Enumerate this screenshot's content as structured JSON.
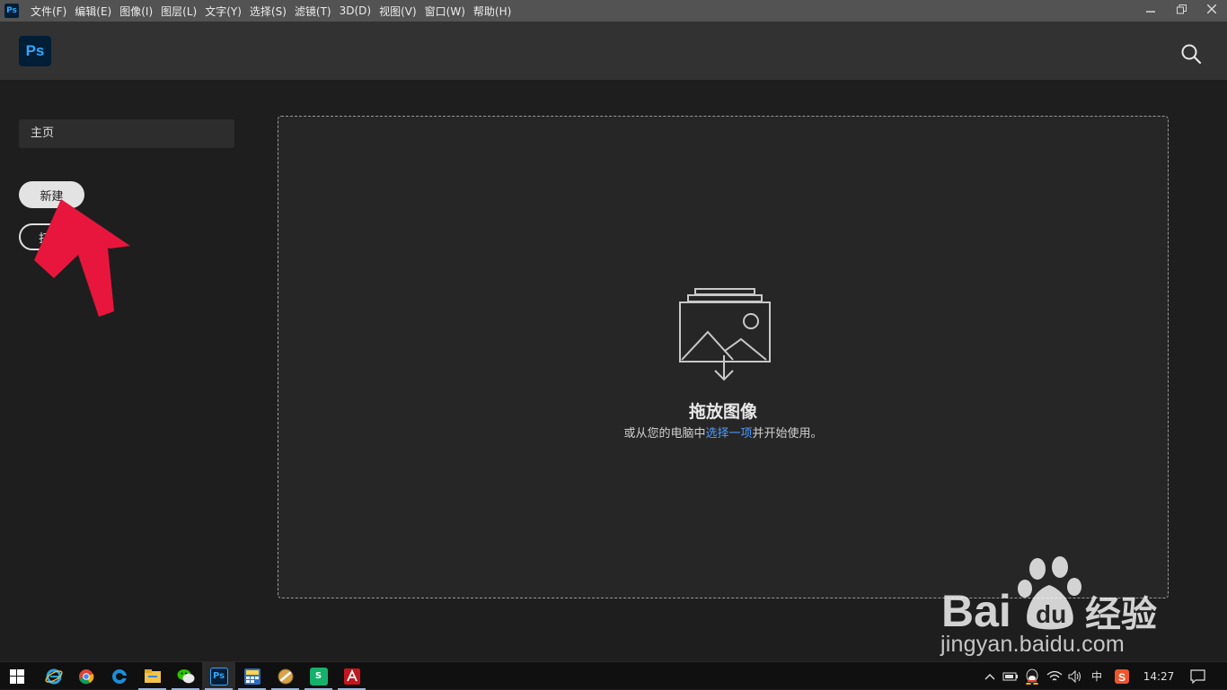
{
  "menubar": {
    "app_icon": "Ps",
    "items": [
      "文件(F)",
      "编辑(E)",
      "图像(I)",
      "图层(L)",
      "文字(Y)",
      "选择(S)",
      "滤镜(T)",
      "3D(D)",
      "视图(V)",
      "窗口(W)",
      "帮助(H)"
    ],
    "window_controls": [
      "minimize-icon",
      "restore-icon",
      "close-icon"
    ]
  },
  "header": {
    "logo": "Ps",
    "search_icon": "search-icon"
  },
  "sidebar": {
    "home_label": "主页",
    "new_label": "新建",
    "open_label": "打"
  },
  "dropzone": {
    "icon": "image-download-icon",
    "title": "拖放图像",
    "subtitle_prefix": "或从您的电脑中",
    "subtitle_link": "选择一项",
    "subtitle_suffix": "并开始使用。"
  },
  "watermark": {
    "brand": "Baidu 经验",
    "url": "jingyan.baidu.com"
  },
  "taskbar": {
    "apps": [
      {
        "icon": "windows-start-icon"
      },
      {
        "icon": "ie-browser-icon"
      },
      {
        "icon": "chrome-icon"
      },
      {
        "icon": "edge-browser-icon"
      },
      {
        "icon": "file-explorer-icon"
      },
      {
        "icon": "wechat-icon"
      },
      {
        "icon": "photoshop-icon",
        "label": "Ps"
      },
      {
        "icon": "calculator-app-icon"
      },
      {
        "icon": "media-app-icon"
      },
      {
        "icon": "wps-sheet-icon",
        "label": "S"
      },
      {
        "icon": "acrobat-icon"
      }
    ],
    "tray": {
      "ime": "中",
      "time": "14:27"
    }
  },
  "colors": {
    "menubar": "#535353",
    "header": "#323232",
    "background": "#1e1e1e",
    "ps_blue": "#31a8ff",
    "link": "#4d9bff",
    "annotation_red": "#e8163c"
  }
}
